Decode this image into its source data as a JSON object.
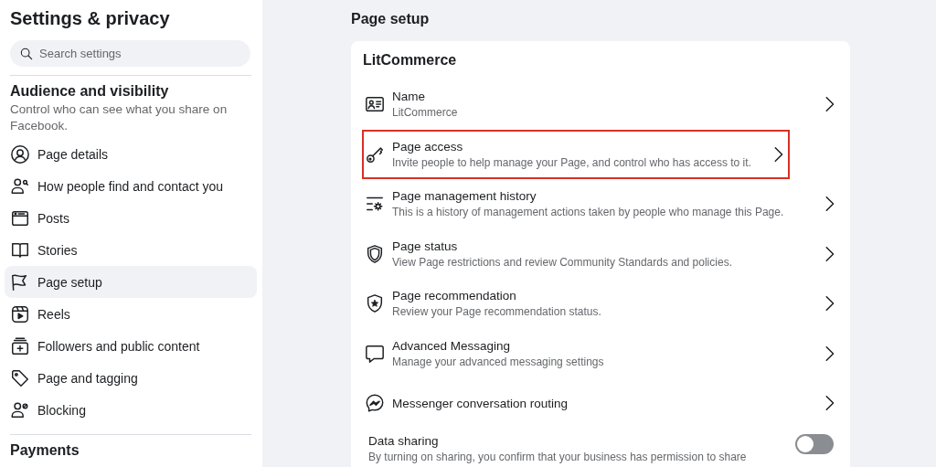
{
  "sidebar": {
    "title": "Settings & privacy",
    "search": {
      "placeholder": "Search settings"
    },
    "section": {
      "title": "Audience and visibility",
      "description": "Control who can see what you share on Facebook."
    },
    "items": [
      {
        "label": "Page details",
        "selected": false
      },
      {
        "label": "How people find and contact you",
        "selected": false
      },
      {
        "label": "Posts",
        "selected": false
      },
      {
        "label": "Stories",
        "selected": false
      },
      {
        "label": "Page setup",
        "selected": true
      },
      {
        "label": "Reels",
        "selected": false
      },
      {
        "label": "Followers and public content",
        "selected": false
      },
      {
        "label": "Page and tagging",
        "selected": false
      },
      {
        "label": "Blocking",
        "selected": false
      }
    ],
    "next_section": {
      "title": "Payments"
    }
  },
  "main": {
    "title": "Page setup",
    "card": {
      "title": "LitCommerce",
      "rows": [
        {
          "kind": "link",
          "title": "Name",
          "subtitle": "LitCommerce",
          "highlighted": false
        },
        {
          "kind": "link",
          "title": "Page access",
          "subtitle": "Invite people to help manage your Page, and control who has access to it.",
          "highlighted": true
        },
        {
          "kind": "link",
          "title": "Page management history",
          "subtitle": "This is a history of management actions taken by people who manage this Page.",
          "highlighted": false
        },
        {
          "kind": "link",
          "title": "Page status",
          "subtitle": "View Page restrictions and review Community Standards and policies.",
          "highlighted": false
        },
        {
          "kind": "link",
          "title": "Page recommendation",
          "subtitle": "Review your Page recommendation status.",
          "highlighted": false
        },
        {
          "kind": "link",
          "title": "Advanced Messaging",
          "subtitle": "Manage your advanced messaging settings",
          "highlighted": false
        },
        {
          "kind": "link",
          "title": "Messenger conversation routing",
          "highlighted": false
        },
        {
          "kind": "toggle",
          "title": "Data sharing",
          "subtitle": "By turning on sharing, you confirm that your business has permission to share",
          "on": false
        }
      ]
    }
  }
}
